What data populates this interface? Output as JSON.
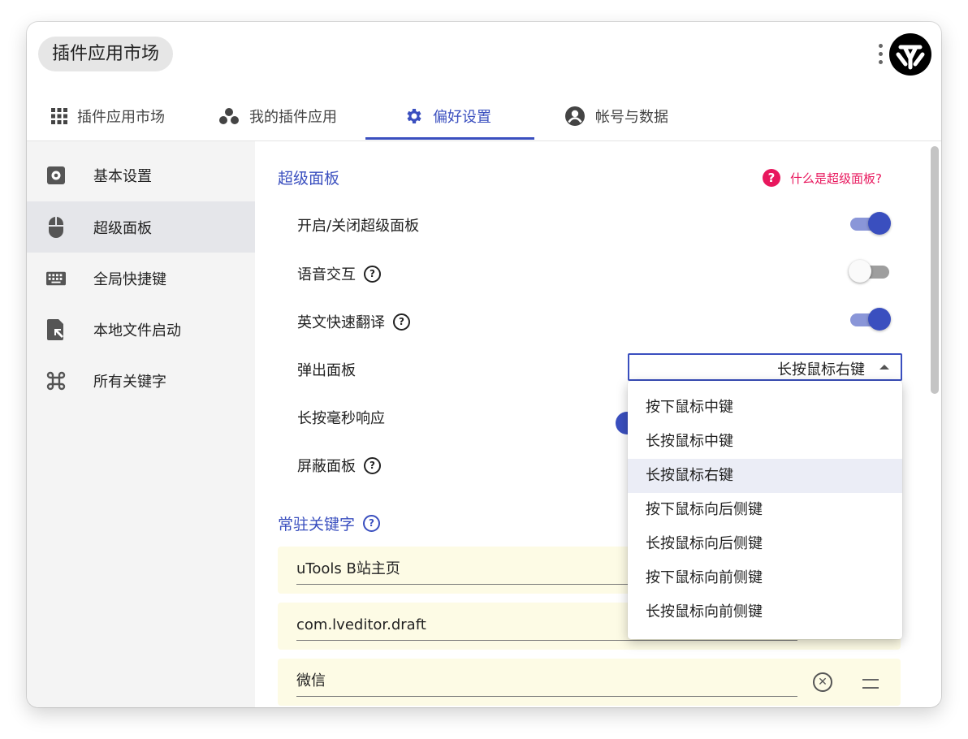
{
  "header": {
    "search_text": "插件应用市场"
  },
  "tabs": [
    {
      "label": "插件应用市场",
      "icon": "grid-icon"
    },
    {
      "label": "我的插件应用",
      "icon": "apps-cluster-icon"
    },
    {
      "label": "偏好设置",
      "icon": "gear-icon",
      "active": true
    },
    {
      "label": "帐号与数据",
      "icon": "account-circle-icon"
    }
  ],
  "sidebar": {
    "items": [
      {
        "label": "基本设置",
        "icon": "settings-box-icon"
      },
      {
        "label": "超级面板",
        "icon": "mouse-icon",
        "active": true
      },
      {
        "label": "全局快捷键",
        "icon": "keyboard-icon"
      },
      {
        "label": "本地文件启动",
        "icon": "file-launch-icon"
      },
      {
        "label": "所有关键字",
        "icon": "command-key-icon"
      }
    ]
  },
  "content": {
    "section_title": "超级面板",
    "help_link": "什么是超级面板?",
    "rows": {
      "toggle_panel": {
        "label": "开启/关闭超级面板",
        "on": true
      },
      "voice": {
        "label": "语音交互",
        "on": false
      },
      "translate": {
        "label": "英文快速翻译",
        "on": true
      },
      "popup": {
        "label": "弹出面板",
        "value": "长按鼠标右键"
      },
      "long_press": {
        "label": "长按毫秒响应"
      },
      "block": {
        "label": "屏蔽面板"
      }
    },
    "keywords_title": "常驻关键字",
    "keywords": [
      "uTools B站主页",
      "com.lveditor.draft",
      "微信"
    ]
  },
  "dropdown": {
    "options": [
      "按下鼠标中键",
      "长按鼠标中键",
      "长按鼠标右键",
      "按下鼠标向后侧键",
      "长按鼠标向后侧键",
      "按下鼠标向前侧键",
      "长按鼠标向前侧键"
    ],
    "selected": "长按鼠标右键"
  },
  "colors": {
    "accent": "#3a4fbf",
    "help_link": "#e8175d",
    "keyword_bg": "#fdfbe5"
  }
}
